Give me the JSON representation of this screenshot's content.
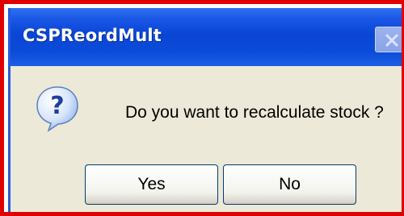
{
  "dialog": {
    "title": "CSPReordMult",
    "message": "Do you want to recalculate stock ?",
    "icon": "question-icon",
    "close_icon": "close-icon",
    "buttons": {
      "yes_label": "Yes",
      "no_label": "No"
    }
  },
  "colors": {
    "highlight_border": "#e10000",
    "titlebar": "#0a45d6",
    "dialog_background": "#ece9d8",
    "button_border": "#003c74"
  }
}
